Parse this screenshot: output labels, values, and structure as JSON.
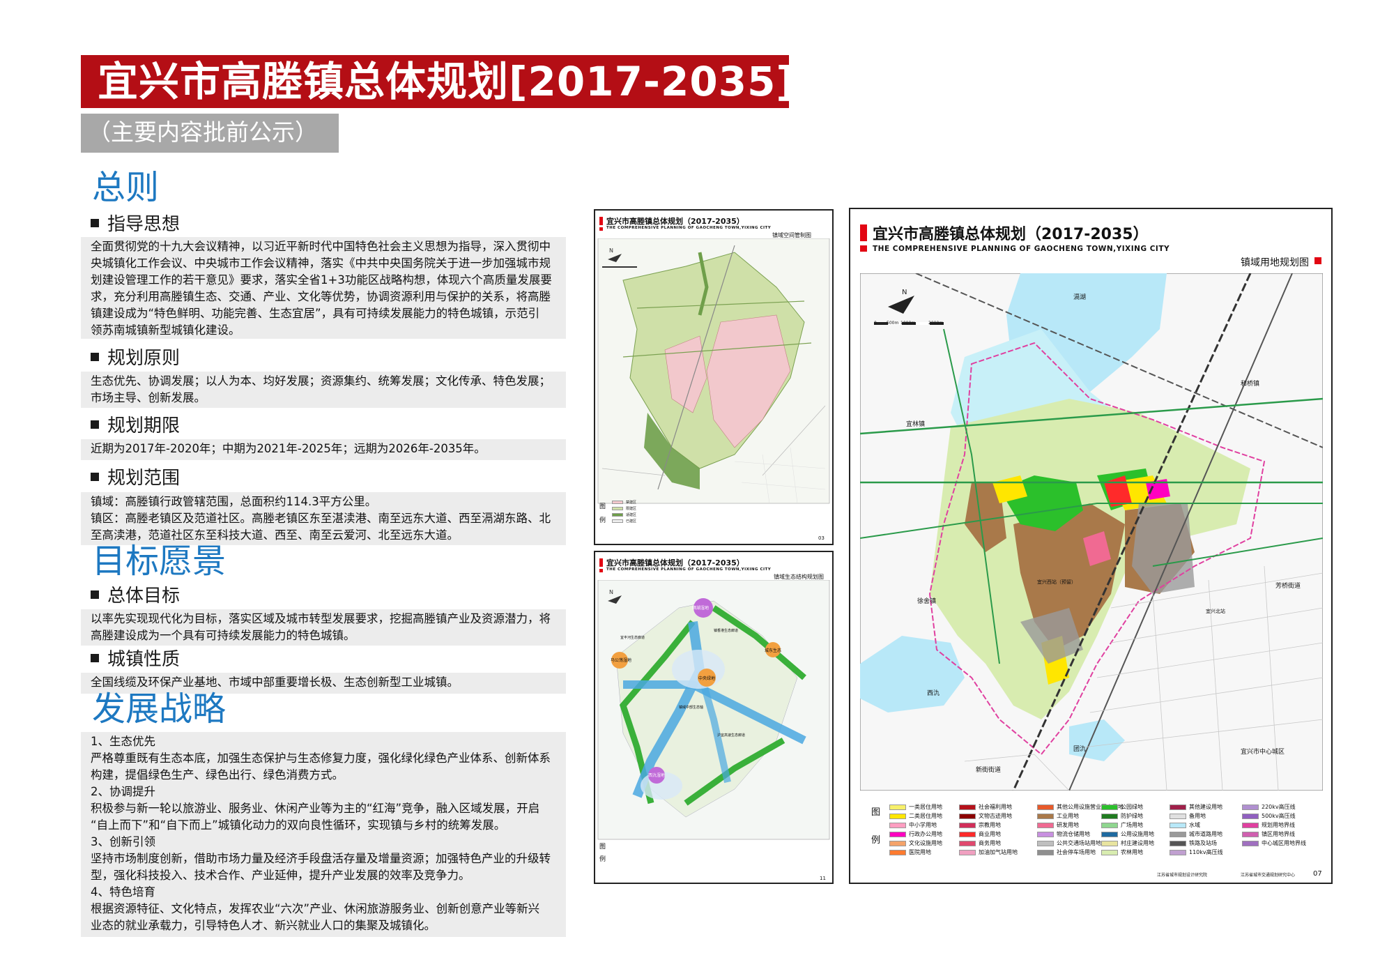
{
  "header": {
    "title": "宜兴市高塍镇总体规划[2017-2035]",
    "subtitle": "（主要内容批前公示）"
  },
  "sections": {
    "general": {
      "heading": "总则",
      "guiding": {
        "label": "指导思想",
        "lines": [
          "全面贯彻党的十九大会议精神，以习近平新时代中国特色社会主义思想为指导，深入贯彻中",
          "央城镇化工作会议、中央城市工作会议精神，落实《中共中央国务院关于进一步加强城市规",
          "划建设管理工作的若干意见》要求，落实全省1+3功能区战略构想，体现六个高质量发展要",
          "求，充分利用高塍镇生态、交通、产业、文化等优势，协调资源利用与保护的关系，将高塍",
          "镇建设成为“特色鲜明、功能完善、生态宜居”，具有可持续发展能力的特色城镇，示范引",
          "领苏南城镇新型城镇化建设。"
        ]
      },
      "principles": {
        "label": "规划原则",
        "lines": [
          "生态优先、协调发展；以人为本、均好发展；资源集约、统筹发展；文化传承、特色发展；",
          "市场主导、创新发展。"
        ]
      },
      "period": {
        "label": "规划期限",
        "lines": [
          "近期为2017年-2020年；中期为2021年-2025年；远期为2026年-2035年。"
        ]
      },
      "scope": {
        "label": "规划范围",
        "lines": [
          "镇域：高塍镇行政管辖范围，总面积约114.3平方公里。",
          "镇区：高塍老镇区及范道社区。高塍老镇区东至湛渎港、南至远东大道、西至滆湖东路、北",
          "至高渎港，范道社区东至科技大道、西至、南至云爱河、北至远东大道。"
        ]
      }
    },
    "vision": {
      "heading": "目标愿景",
      "overall": {
        "label": "总体目标",
        "lines": [
          "以率先实现现代化为目标，落实区域及城市转型发展要求，挖掘高塍镇产业及资源潜力，将",
          "高塍建设成为一个具有可持续发展能力的特色城镇。"
        ]
      },
      "nature": {
        "label": "城镇性质",
        "lines": [
          "全国线缆及环保产业基地、市域中部重要增长极、生态创新型工业城镇。"
        ]
      }
    },
    "strategy": {
      "heading": "发展战略",
      "lines": [
        "1、生态优先",
        "严格尊重既有生态本底，加强生态保护与生态修复力度，强化绿化绿色产业体系、创新体系",
        "构建，提倡绿色生产、绿色出行、绿色消费方式。",
        "2、协调提升",
        "积极参与新一轮以旅游业、服务业、休闲产业等为主的“红海”竞争，融入区域发展，开启",
        "“自上而下”和“自下而上”城镇化动力的双向良性循环，实现镇与乡村的统筹发展。",
        "3、创新引领",
        "坚持市场制度创新，借助市场力量及经济手段盘活存量及增量资源；加强特色产业的升级转",
        "型，强化科技投入、技术合作、产业延伸，提升产业发展的效率及竞争力。",
        "4、特色培育",
        "根据资源特征、文化特点，发挥农业“六次”产业、休闲旅游服务业、创新创意产业等新兴",
        "业态的就业承载力，引导特色人才、新兴就业人口的集聚及城镇化。"
      ]
    }
  },
  "maps": {
    "spatial": {
      "title": "宜兴市高塍镇总体规划（2017-2035）",
      "en": "THE COMPREHENSIVE PLANNING OF GAOCHENG TOWN,YIXING CITY",
      "name": "镇域空间管制图",
      "page": "03",
      "legend_head": [
        "图",
        "例"
      ],
      "legend": [
        "禁建区",
        "限建区",
        "适建区",
        "已建区"
      ]
    },
    "ecology": {
      "title": "宜兴市高塍镇总体规划（2017-2035）",
      "en": "THE COMPREHENSIVE PLANNING OF GAOCHENG TOWN,YIXING CITY",
      "name": "镇域生态结构规划图",
      "page": "11",
      "legend_head": [
        "图",
        "例"
      ],
      "bubbles": [
        "隔湖湿地",
        "马公荡湿地",
        "中央绿地",
        "西氿湿地",
        "城东生态"
      ],
      "labels": [
        "宜丰河生态廊道",
        "镇香港生态廊道",
        "镇域中部生态轴",
        "沪宜高速生态廊道"
      ]
    },
    "landuse": {
      "title": "宜兴市高塍镇总体规划（2017-2035）",
      "en": "THE COMPREHENSIVE PLANNING OF GAOCHENG TOWN,YIXING CITY",
      "name": "镇域用地规划图",
      "page": "07",
      "scale": [
        "0",
        "500m",
        "1000m",
        "2000m"
      ],
      "north": "N",
      "places": [
        "和桥镇",
        "宜林镇",
        "宜兴市中心城区",
        "新街街道",
        "芳桥街道",
        "徐舍镇",
        "宜兴西站（预留）",
        "宜兴北站"
      ],
      "water": [
        "滆湖",
        "西氿",
        "团氿"
      ],
      "legend_head": [
        "图",
        "例"
      ],
      "legend": [
        {
          "label": "一类居住用地",
          "color": "#f7f06a"
        },
        {
          "label": "二类居住用地",
          "color": "#ffe600"
        },
        {
          "label": "中小学用地",
          "color": "#ff9ec1"
        },
        {
          "label": "行政办公用地",
          "color": "#ff00c0"
        },
        {
          "label": "文化设施用地",
          "color": "#f4a36a"
        },
        {
          "label": "医院用地",
          "color": "#ff7b30"
        },
        {
          "label": "社会福利用地",
          "color": "#b5121b"
        },
        {
          "label": "文物古迹用地",
          "color": "#8b0000"
        },
        {
          "label": "宗教用地",
          "color": "#d22e59"
        },
        {
          "label": "商业用地",
          "color": "#ff2a2a"
        },
        {
          "label": "商务用地",
          "color": "#e0496e"
        },
        {
          "label": "加油加气站用地",
          "color": "#f0a0c0"
        },
        {
          "label": "其他公用设施营业网点用地",
          "color": "#e85a2a"
        },
        {
          "label": "工业用地",
          "color": "#a9794a"
        },
        {
          "label": "研发用地",
          "color": "#f06a92"
        },
        {
          "label": "物流仓储用地",
          "color": "#c890e0"
        },
        {
          "label": "公共交通场站用地",
          "color": "#bfbfbf"
        },
        {
          "label": "社会停车场用地",
          "color": "#8f8f8f"
        },
        {
          "label": "公园绿地",
          "color": "#2bc02b"
        },
        {
          "label": "防护绿地",
          "color": "#1f7a1f"
        },
        {
          "label": "广场用地",
          "color": "#8fd68f"
        },
        {
          "label": "公用设施用地",
          "color": "#1f6aa0"
        },
        {
          "label": "村庄建设用地",
          "color": "#e8e4a0"
        },
        {
          "label": "农林用地",
          "color": "#d8ecb0"
        },
        {
          "label": "其他建设用地",
          "color": "#a0204a"
        },
        {
          "label": "备用地",
          "color": "#e0e0e0"
        },
        {
          "label": "水域",
          "color": "#b8e8f8"
        },
        {
          "label": "城市道路用地",
          "color": "#9a9a9a"
        },
        {
          "label": "铁路及站场",
          "color": "#555555"
        },
        {
          "label": "110kv高压线",
          "color": "#c0a0d0"
        },
        {
          "label": "220kv高压线",
          "color": "#b090d0"
        },
        {
          "label": "500kv高压线",
          "color": "#9060c0"
        },
        {
          "label": "规划用地界线",
          "color": "#e040a0"
        },
        {
          "label": "镇区用地界线",
          "color": "#d060b0"
        },
        {
          "label": "中心城区用地界线",
          "color": "#a070c0"
        }
      ],
      "footer": [
        "江苏省城市规划设计研究院",
        "江苏省城市交通规划研究中心"
      ]
    }
  }
}
